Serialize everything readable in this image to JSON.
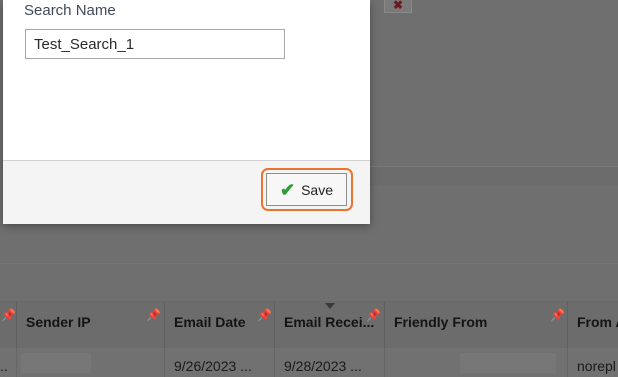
{
  "dialog": {
    "field_label": "Search Name",
    "search_name_value": "Test_Search_1",
    "save_label": "Save"
  },
  "grid": {
    "columns": [
      {
        "label": ""
      },
      {
        "label": "Sender IP"
      },
      {
        "label": "Email Date"
      },
      {
        "label": "Email Recei..."
      },
      {
        "label": "Friendly From"
      },
      {
        "label": "From A"
      }
    ],
    "row": [
      "..",
      "",
      "9/26/2023 ...",
      "9/28/2023 ...",
      "",
      "norepl"
    ]
  },
  "icons": {
    "pin": "pin-icon",
    "check": "checkmark-icon",
    "close": "close-icon",
    "sort": "sort-caret-icon"
  },
  "colors": {
    "focus_ring": "#e8742e",
    "check": "#2e9c3a",
    "overlay": "#6f6f6f"
  }
}
